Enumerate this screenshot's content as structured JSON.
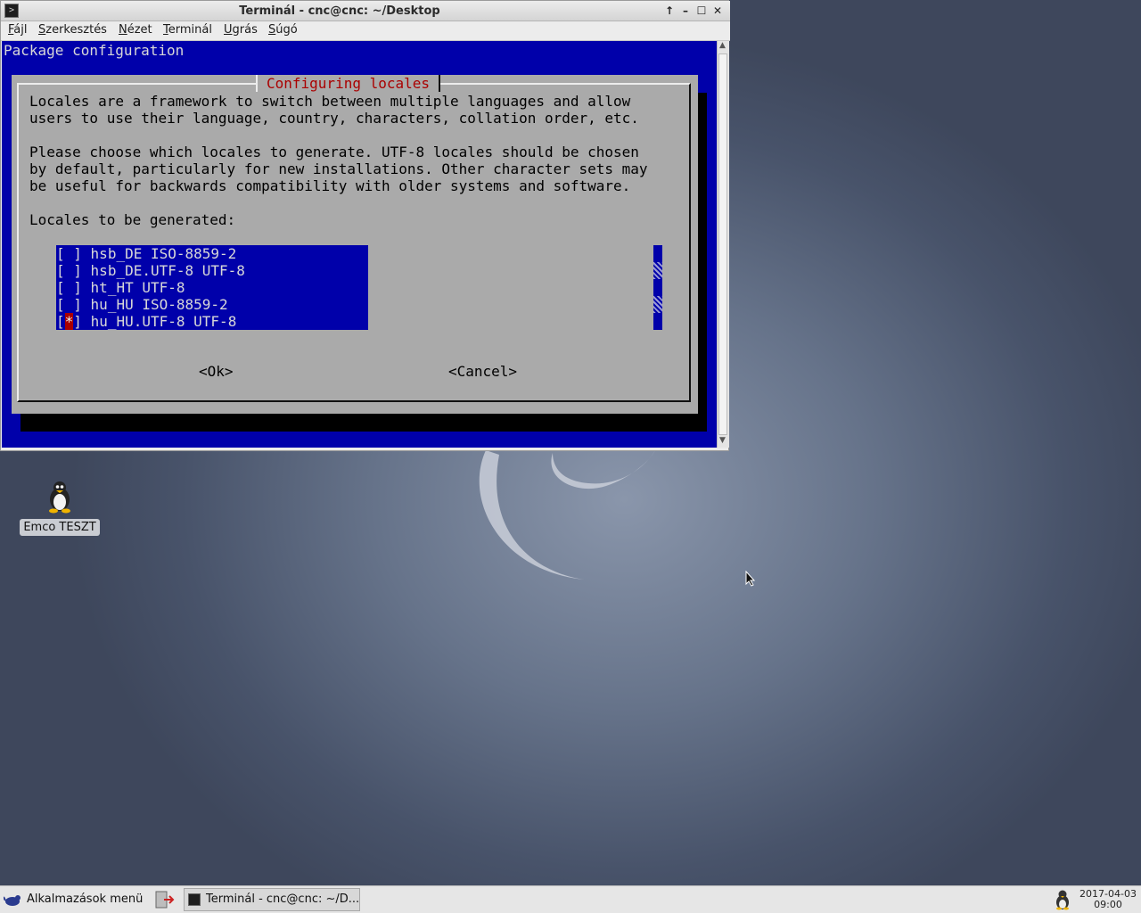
{
  "window": {
    "title": "Terminál - cnc@cnc: ~/Desktop",
    "controls": [
      "↑",
      "–",
      "☐",
      "✕"
    ]
  },
  "menubar": {
    "items": [
      {
        "u": "F",
        "rest": "ájl"
      },
      {
        "u": "S",
        "rest": "zerkesztés"
      },
      {
        "u": "N",
        "rest": "ézet"
      },
      {
        "u": "T",
        "rest": "erminál"
      },
      {
        "u": "U",
        "rest": "grás"
      },
      {
        "u": "S",
        "rest": "úgó"
      }
    ]
  },
  "terminal": {
    "header": "Package configuration",
    "dialog": {
      "title": "Configuring locales",
      "paragraph1": [
        "Locales are a framework to switch between multiple languages and allow",
        "users to use their language, country, characters, collation order, etc."
      ],
      "paragraph2": [
        "Please choose which locales to generate. UTF-8 locales should be chosen",
        "by default, particularly for new installations. Other character sets may",
        "be useful for backwards compatibility with older systems and software."
      ],
      "list_label": "Locales to be generated:",
      "locales": [
        {
          "checkbox": "[ ]",
          "name": "hsb_DE ISO-8859-2"
        },
        {
          "checkbox": "[ ]",
          "name": "hsb_DE.UTF-8 UTF-8"
        },
        {
          "checkbox": "[ ]",
          "name": "ht_HT UTF-8"
        },
        {
          "checkbox": "[ ]",
          "name": "hu_HU ISO-8859-2"
        },
        {
          "checkbox_open": "[",
          "checkbox_mark": "*",
          "checkbox_close": "]",
          "name": "hu_HU.UTF-8 UTF-8"
        }
      ],
      "ok": "<Ok>",
      "cancel": "<Cancel>"
    }
  },
  "desktop": {
    "icon_label": "Emco TESZT"
  },
  "taskbar": {
    "start_label": "Alkalmazások menü",
    "task_label": "Terminál - cnc@cnc: ~/D...",
    "clock_date": "2017-04-03",
    "clock_time": "09:00"
  },
  "colors": {
    "terminal_bg": "#0000aa",
    "dialog_bg": "#aaaaaa",
    "dialog_title": "#aa0000"
  }
}
